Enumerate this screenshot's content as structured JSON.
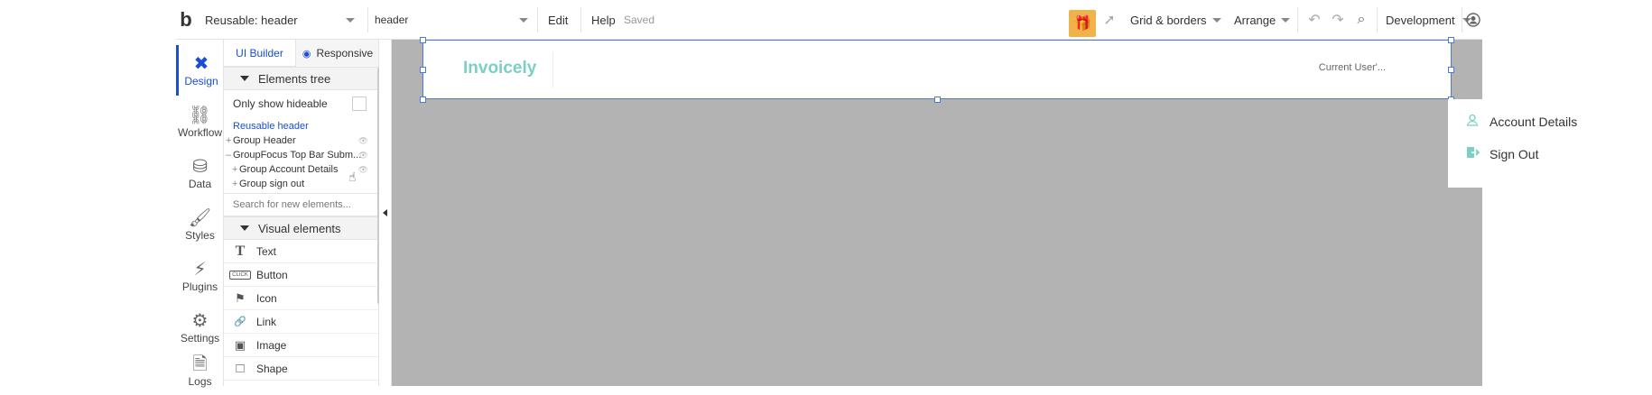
{
  "topbar": {
    "page_selector": "Reusable: header",
    "element_selector": "header",
    "menu_edit": "Edit",
    "menu_help": "Help",
    "status": "Saved",
    "grid_borders": "Grid & borders",
    "arrange": "Arrange",
    "environment": "Development"
  },
  "rail": {
    "items": [
      {
        "label": "Design",
        "icon": "design-icon"
      },
      {
        "label": "Workflow",
        "icon": "workflow-icon"
      },
      {
        "label": "Data",
        "icon": "database-icon"
      },
      {
        "label": "Styles",
        "icon": "brush-icon"
      },
      {
        "label": "Plugins",
        "icon": "plug-icon"
      },
      {
        "label": "Settings",
        "icon": "gear-icon"
      },
      {
        "label": "Logs",
        "icon": "document-icon"
      }
    ]
  },
  "panel": {
    "tab_ui_builder": "UI Builder",
    "tab_responsive": "Responsive",
    "elements_tree": "Elements tree",
    "only_show_hideable": "Only show hideable",
    "reusable_header": "Reusable header",
    "tree": [
      {
        "prefix": "+",
        "label": "Group Header"
      },
      {
        "prefix": "–",
        "label": "GroupFocus Top Bar Subm..."
      },
      {
        "prefix": "+",
        "label": "Group Account Details"
      },
      {
        "prefix": "+",
        "label": "Group sign out"
      }
    ],
    "search_placeholder": "Search for new elements...",
    "visual_elements": "Visual elements",
    "visual_items": [
      {
        "label": "Text",
        "icon": "T"
      },
      {
        "label": "Button",
        "icon": "CLICK"
      },
      {
        "label": "Icon",
        "icon": "⚑"
      },
      {
        "label": "Link",
        "icon": "🔗"
      },
      {
        "label": "Image",
        "icon": "▣"
      },
      {
        "label": "Shape",
        "icon": "□"
      }
    ]
  },
  "canvas": {
    "brand": "Invoicely",
    "current_user": "Current User'...",
    "dropdown": [
      {
        "label": "Account Details",
        "icon": "user-icon"
      },
      {
        "label": "Sign Out",
        "icon": "sign-out-icon"
      }
    ]
  },
  "colors": {
    "accent_blue": "#1a4dd8",
    "brand_teal": "#7ccfc5",
    "canvas_gray": "#b3b3b3",
    "gift_orange": "#f0b34a"
  }
}
